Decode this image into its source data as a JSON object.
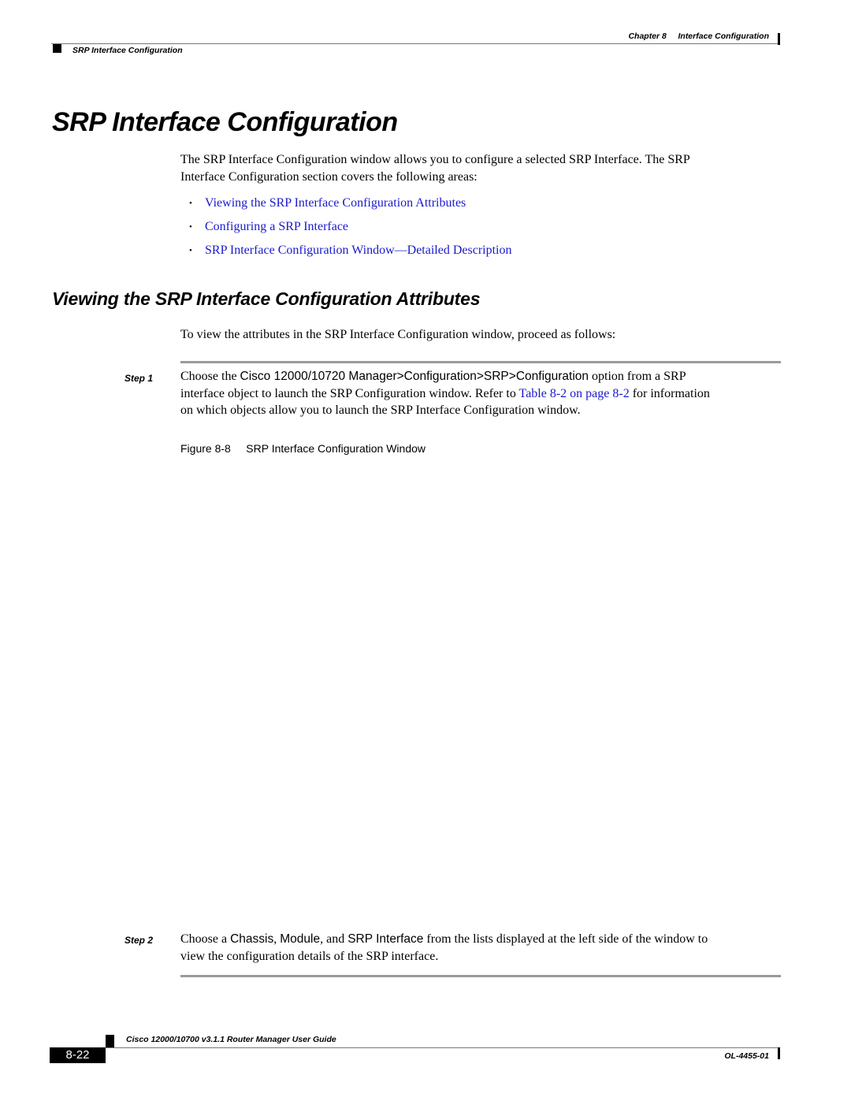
{
  "header": {
    "chapter": "Chapter 8",
    "chapter_title": "Interface Configuration",
    "section": "SRP Interface Configuration"
  },
  "main": {
    "title": "SRP Interface Configuration",
    "intro_line1": "The SRP Interface Configuration window allows you to configure a selected SRP Interface. The SRP",
    "intro_line2": "Interface Configuration section covers the following areas:",
    "bullets": [
      {
        "bullet": "•",
        "label": "Viewing the SRP Interface Configuration Attributes"
      },
      {
        "bullet": "•",
        "label": "Configuring a SRP Interface"
      },
      {
        "bullet": "•",
        "label": "SRP Interface Configuration Window—Detailed Description"
      }
    ],
    "subsection_title": "Viewing the SRP Interface Configuration Attributes",
    "subsection_intro": "To view the attributes in the SRP Interface Configuration window, proceed as follows:",
    "steps": [
      {
        "label": "Step 1",
        "pre": "Choose the ",
        "ui_path": "Cisco 12000/10720 Manager>Configuration>SRP>Configuration",
        "post1": " option from a SRP",
        "line2_pre": "interface object to launch the SRP Configuration window. Refer to ",
        "link": "Table 8-2 on page 8-2",
        "line2_post": " for information",
        "line3": "on which objects allow you to launch the SRP Interface Configuration window."
      },
      {
        "label": "Step 2",
        "pre": "Choose a ",
        "ui1": "Chassis",
        "sep1": ", ",
        "ui2": "Module",
        "sep2": ", and ",
        "ui3": "SRP Interface",
        "post": " from the lists displayed at the left side of the window to",
        "line2": "view the configuration details of the SRP interface."
      }
    ],
    "figure": {
      "number": "Figure 8-8",
      "caption": "SRP Interface Configuration Window"
    }
  },
  "footer": {
    "guide_title": "Cisco 12000/10700 v3.1.1 Router Manager User Guide",
    "page_number": "8-22",
    "doc_number": "OL-4455-01"
  },
  "colors": {
    "link": "#1a1acc",
    "rule": "#9a9a9a"
  }
}
